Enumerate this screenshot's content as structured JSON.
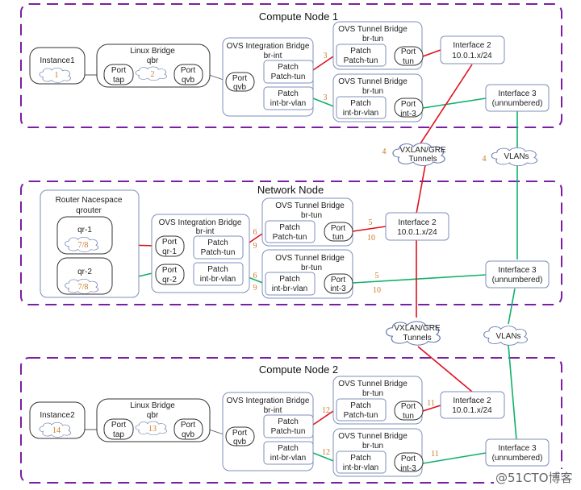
{
  "compute1": {
    "title": "Compute Node 1",
    "instance": {
      "label": "Instance1",
      "num": "1"
    },
    "linux_bridge": {
      "title": "Linux  Bridge",
      "sub": "qbr",
      "num": "2",
      "port_tap": [
        "Port",
        "tap"
      ],
      "port_qvb": [
        "Port",
        "qvb"
      ]
    },
    "int_bridge": {
      "title": "OVS Integration Bridge",
      "sub": "br-int",
      "port_qvb": [
        "Port",
        "qvb"
      ],
      "patch_tun": [
        "Patch",
        "Patch-tun"
      ],
      "patch_vlan": [
        "Patch",
        "int-br-vlan"
      ]
    },
    "tun_bridge1": {
      "title": "OVS Tunnel Bridge",
      "sub": "br-tun",
      "patch": [
        "Patch",
        "Patch-tun"
      ],
      "port": [
        "Port",
        "tun"
      ]
    },
    "tun_bridge2": {
      "title": "OVS Tunnel Bridge",
      "sub": "br-tun",
      "patch": [
        "Patch",
        "int-br-vlan"
      ],
      "port": [
        "Port",
        "int-3"
      ]
    },
    "iface2": [
      "Interface 2",
      "10.0.1.x/24"
    ],
    "iface3": [
      "Interface 3",
      "(unnumbered)"
    ],
    "nums": {
      "patch_tun": "3",
      "patch_vlan": "3"
    }
  },
  "clouds_top": {
    "tunnels": [
      "VXLAN/GRE",
      "Tunnels"
    ],
    "vlans": "VLANs",
    "num_tunnels": "4",
    "num_vlans": "4"
  },
  "network": {
    "title": "Network Node",
    "router": {
      "title": "Router Nacespace",
      "sub": "qrouter",
      "qr1": "qr-1",
      "qr2": "qr-2",
      "num1": "7/8",
      "num2": "7/8"
    },
    "int_bridge": {
      "title": "OVS Integration Bridge",
      "sub": "br-int",
      "port_qr1": [
        "Port",
        "qr-1"
      ],
      "port_qr2": [
        "Port",
        "qr-2"
      ],
      "patch_tun": [
        "Patch",
        "Patch-tun"
      ],
      "patch_vlan": [
        "Patch",
        "int-br-vlan"
      ]
    },
    "tun_bridge1": {
      "title": "OVS Tunnel Bridge",
      "sub": "br-tun",
      "patch": [
        "Patch",
        "Patch-tun"
      ],
      "port": [
        "Port",
        "tun"
      ]
    },
    "tun_bridge2": {
      "title": "OVS Tunnel Bridge",
      "sub": "br-tun",
      "patch": [
        "Patch",
        "int-br-vlan"
      ],
      "port": [
        "Port",
        "int-3"
      ]
    },
    "iface2": [
      "Interface 2",
      "10.0.1.x/24"
    ],
    "iface3": [
      "Interface 3",
      "(unnumbered)"
    ],
    "nums": {
      "a6": "6",
      "a9": "9",
      "b6": "6",
      "b9": "9",
      "c5": "5",
      "c10": "10",
      "d5": "5",
      "d10": "10"
    }
  },
  "clouds_mid": {
    "tunnels": [
      "VXLAN/GRE",
      "Tunnels"
    ],
    "vlans": "VLANs"
  },
  "compute2": {
    "title": "Compute Node 2",
    "instance": {
      "label": "Instance2",
      "num": "14"
    },
    "linux_bridge": {
      "title": "Linux  Bridge",
      "sub": "qbr",
      "num": "13",
      "port_tap": [
        "Port",
        "tap"
      ],
      "port_qvb": [
        "Port",
        "qvb"
      ]
    },
    "int_bridge": {
      "title": "OVS Integration Bridge",
      "sub": "br-int",
      "port_qvb": [
        "Port",
        "qvb"
      ],
      "patch_tun": [
        "Patch",
        "Patch-tun"
      ],
      "patch_vlan": [
        "Patch",
        "int-br-vlan"
      ]
    },
    "tun_bridge1": {
      "title": "OVS Tunnel Bridge",
      "sub": "br-tun",
      "patch": [
        "Patch",
        "Patch-tun"
      ],
      "port": [
        "Port",
        "tun"
      ]
    },
    "tun_bridge2": {
      "title": "OVS Tunnel Bridge",
      "sub": "br-tun",
      "patch": [
        "Patch",
        "int-br-vlan"
      ],
      "port": [
        "Port",
        "int-3"
      ]
    },
    "iface2": [
      "Interface 2",
      "10.0.1.x/24"
    ],
    "iface3": [
      "Interface 3",
      "(unnumbered)"
    ],
    "nums": {
      "patch_tun": "12",
      "patch_vlan": "12",
      "tun": "11",
      "int3": "11"
    }
  },
  "watermark": "@51CTO博客",
  "colors": {
    "tunnel_line": "#e0101e",
    "vlan_line": "#10b06a",
    "node_frame": "#7b1fa2",
    "step_number": "#c97a2a"
  }
}
